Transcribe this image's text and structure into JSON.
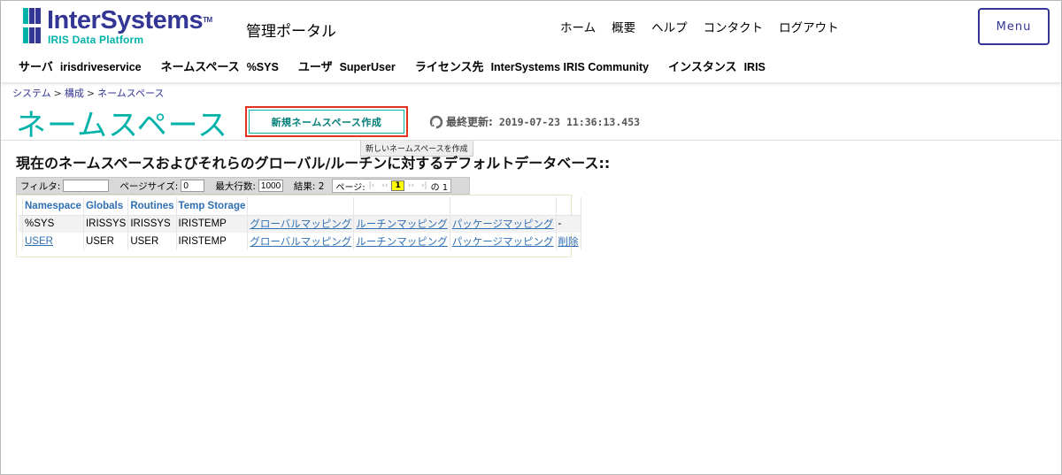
{
  "header": {
    "brand": "InterSystems",
    "brand_tm": "TM",
    "product": "IRIS Data Platform",
    "portal_title": "管理ポータル",
    "nav": [
      "ホーム",
      "概要",
      "ヘルプ",
      "コンタクト",
      "ログアウト"
    ],
    "menu_label": "Menu",
    "brand_color": "#333695",
    "accent_color": "#00b2a9"
  },
  "infobar": {
    "server_label": "サーバ",
    "server_value": "irisdriveservice",
    "namespace_label": "ネームスペース",
    "namespace_value": "%SYS",
    "user_label": "ユーザ",
    "user_value": "SuperUser",
    "license_label": "ライセンス先",
    "license_value": "InterSystems IRIS Community",
    "instance_label": "インスタンス",
    "instance_value": "IRIS"
  },
  "breadcrumb": {
    "items": [
      "システム",
      "構成",
      "ネームスペース"
    ],
    "separator": ">"
  },
  "page": {
    "title": "ネームスペース",
    "new_button": "新規ネームスペース作成",
    "tooltip": "新しいネームスペースを作成",
    "last_update_label": "最終更新:",
    "last_update_value": "2019-07-23 11:36:13.453",
    "heading": "現在のネームスペースおよびそれらのグローバル/ルーチンに対するデフォルトデータベース::"
  },
  "table_nav": {
    "filter_label": "フィルタ:",
    "filter_value": "",
    "page_size_label": "ページサイズ:",
    "page_size_value": "0",
    "max_rows_label": "最大行数:",
    "max_rows_value": "1000",
    "results_label": "結果: 2",
    "page_label": "ページ:",
    "first": "|‹",
    "prev": "‹‹",
    "current_page": "1",
    "next": "››",
    "last": "›|",
    "of_label": "の 1"
  },
  "table": {
    "columns": [
      "Namespace",
      "Globals",
      "Routines",
      "Temp Storage",
      "",
      "",
      "",
      ""
    ],
    "rows": [
      [
        "%SYS",
        "IRISSYS",
        "IRISSYS",
        "IRISTEMP",
        "グローバルマッピング",
        "ルーチンマッピング",
        "パッケージマッピング",
        "-"
      ],
      [
        "USER",
        "USER",
        "USER",
        "IRISTEMP",
        "グローバルマッピング",
        "ルーチンマッピング",
        "パッケージマッピング",
        "削除"
      ]
    ]
  }
}
